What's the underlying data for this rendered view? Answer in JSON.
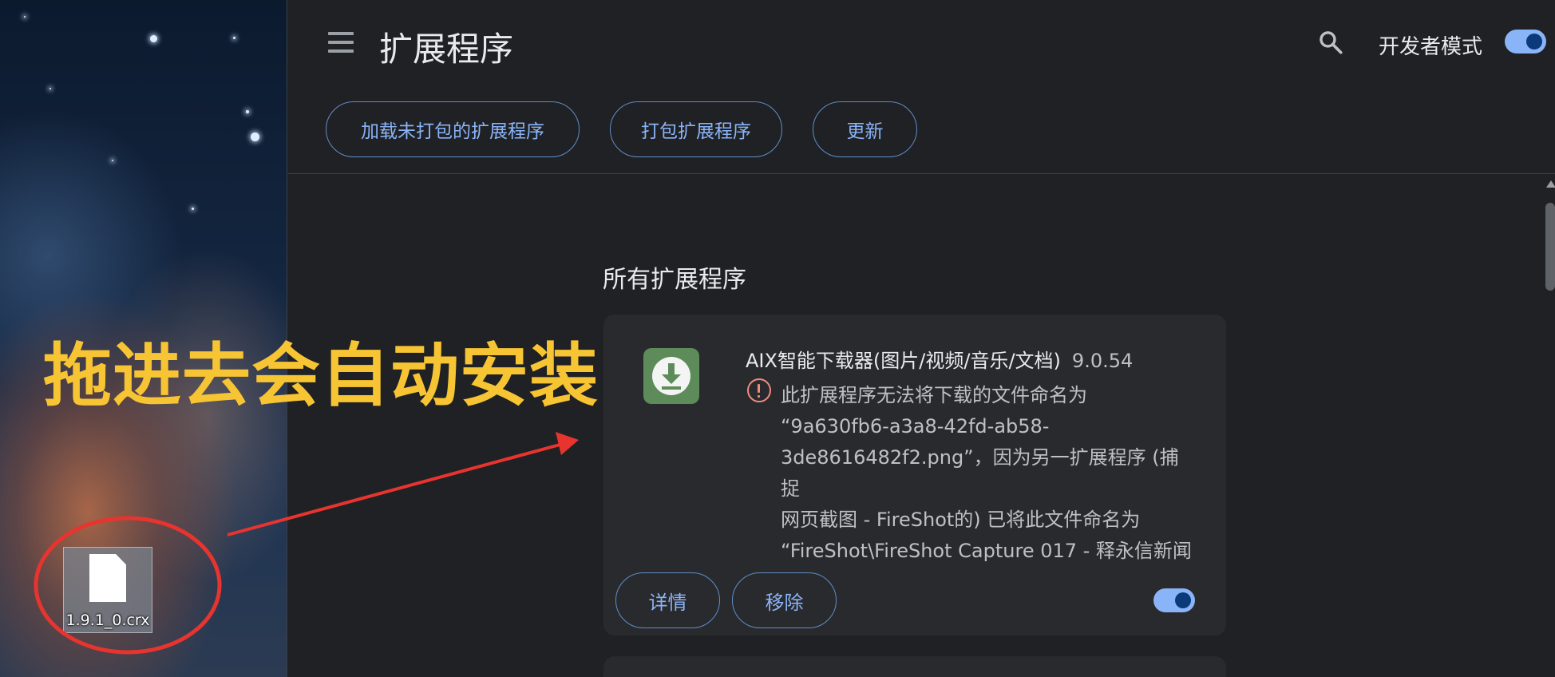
{
  "header": {
    "title": "扩展程序",
    "developer_mode_label": "开发者模式",
    "developer_mode_on": true
  },
  "toolbar": {
    "load_unpacked": "加载未打包的扩展程序",
    "pack_extension": "打包扩展程序",
    "update": "更新"
  },
  "main": {
    "section_title": "所有扩展程序",
    "extensions": [
      {
        "name": "AIX智能下载器(图片/视频/音乐/文档)",
        "version": "9.0.54",
        "error_lines": [
          "此扩展程序无法将下载的文件命名为",
          "“9a630fb6-a3a8-42fd-ab58-",
          "3de8616482f2.png”，因为另一扩展程序 (捕捉",
          "网页截图 - FireShot的) 已将此文件命名为",
          "“FireShot\\FireShot Capture 017 - 释永信新闻"
        ],
        "details_label": "详情",
        "remove_label": "移除",
        "enabled": true
      }
    ]
  },
  "desktop": {
    "file_name": "1.9.1_0.crx",
    "annotation": "拖进去会自动安装"
  },
  "colors": {
    "page_bg": "#202124",
    "card_bg": "#292a2d",
    "accent": "#8ab4f8",
    "annotation": "#f7c433",
    "arrow": "#e8342f",
    "error": "#f28b82"
  }
}
